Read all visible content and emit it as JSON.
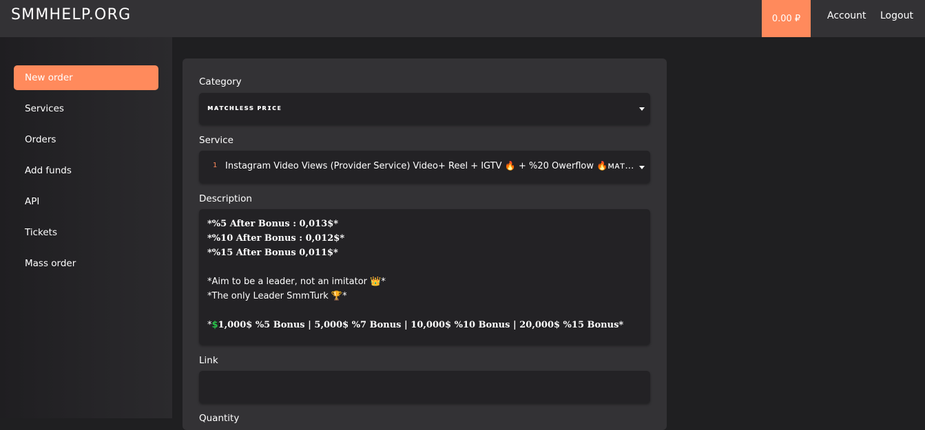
{
  "header": {
    "logo": "SMMHELP.ORG",
    "balance": "0.00 ₽",
    "account_label": "Account",
    "logout_label": "Logout"
  },
  "sidebar": {
    "items": [
      {
        "label": "New order",
        "active": true
      },
      {
        "label": "Services"
      },
      {
        "label": "Orders"
      },
      {
        "label": "Add funds"
      },
      {
        "label": "API"
      },
      {
        "label": "Tickets"
      },
      {
        "label": "Mass order"
      }
    ]
  },
  "form": {
    "category_label": "Category",
    "category_value": "ᴍᴀᴛᴄʜʟᴇss ᴘʀɪᴄᴇ",
    "service_label": "Service",
    "service_number": "1",
    "service_value": "Instagram Video Views (Provider Service) Video+ Reel + IGTV 🔥 + %20 Owerflow 🔥ᴍᴀᴛᴄʜʟ...",
    "description_label": "Description",
    "description_lines": [
      "*%5 After Bonus : 0,013$*",
      "*%10 After Bonus : 0,012$*",
      "*%15 After Bonus 0,011$*",
      "*Aim to be a leader, not an imitator 👑*",
      "*The only Leader SmmTurk 🏆*",
      "1,000$ %5 Bonus | 5,000$ %7 Bonus | 10,000$ %10 Bonus | 20,000$ %15 Bonus*"
    ],
    "description_bonus_prefix": "*",
    "description_bonus_icon": "$",
    "link_label": "Link",
    "link_value": "",
    "quantity_label": "Quantity"
  },
  "colors": {
    "accent": "#ff8a5c",
    "topbar": "#333235",
    "card": "#333235",
    "field": "#232225",
    "background": "#1f1f21"
  }
}
